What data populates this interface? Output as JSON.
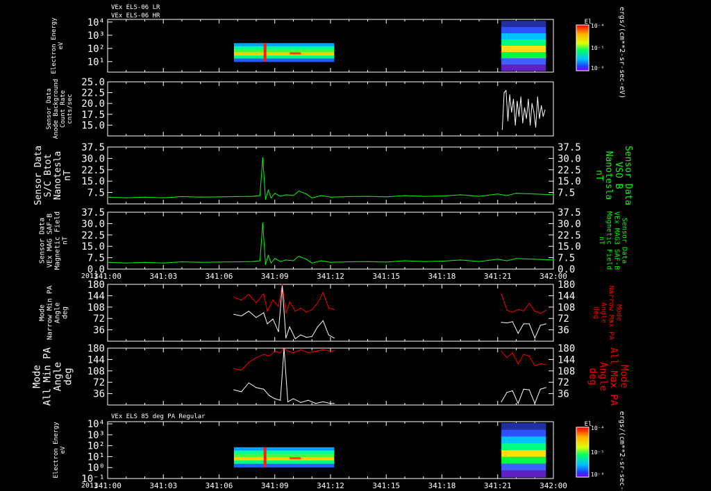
{
  "title_lines": [
    "VEx ELS-06 LR",
    "VEx ELS-06 HR"
  ],
  "bottom_panel_title": "VEx ELS 85 deg PA Regular",
  "colorbar_label": "ergs/(cm**2-sr-sec-eV)",
  "colorbar_title": "El",
  "colorbar_ticks": [
    "10⁻⁴",
    "10⁻⁵",
    "10⁻⁶"
  ],
  "time_axis": {
    "year": "2011",
    "ticks": [
      "341:00",
      "341:03",
      "341:06",
      "341:09",
      "341:12",
      "341:15",
      "341:18",
      "341:21",
      "342:00"
    ]
  },
  "colors": {
    "green": "#00ff00",
    "red": "#ff0000",
    "white": "#ffffff",
    "black": "#000000"
  },
  "chart_data": [
    {
      "type": "heatmap",
      "name": "energy-spectrogram-top",
      "ylabel": [
        "Electron Energy",
        "eV"
      ],
      "ytick_labels": [
        "10⁴",
        "10³",
        "10²",
        "10¹"
      ],
      "x_segments": [
        [
          6.8,
          12.2
        ],
        [
          21.2,
          23.6
        ]
      ]
    },
    {
      "type": "line",
      "name": "background-counts",
      "ylabel": [
        "Sensor Data",
        "Anode Background",
        "Count Rate",
        "cnts/sec"
      ],
      "ylim": [
        12.5,
        25.0
      ],
      "ytick_labels": [
        "25.0",
        "22.5",
        "20.0",
        "17.5",
        "15.0"
      ],
      "series": [
        {
          "color": "white",
          "x": [
            21.25,
            21.35,
            21.45,
            21.55,
            21.65,
            21.75,
            21.85,
            21.95,
            22.05,
            22.15,
            22.25,
            22.35,
            22.45,
            22.55,
            22.65,
            22.75,
            22.85,
            22.95,
            23.05,
            23.15,
            23.25,
            23.35,
            23.45,
            23.55
          ],
          "y": [
            14.0,
            22.5,
            23.0,
            16.0,
            22.0,
            18.0,
            21.0,
            15.0,
            20.5,
            17.0,
            21.5,
            15.5,
            19.0,
            16.5,
            21.0,
            15.0,
            20.0,
            18.0,
            14.5,
            21.5,
            16.5,
            19.5,
            17.0,
            18.5
          ]
        }
      ]
    },
    {
      "type": "line",
      "name": "mag-sc-btot",
      "ylabel": [
        "Sensor Data",
        "S/C Btot",
        "Nanotesla",
        "nT"
      ],
      "ylabel_right": [
        "Sensor Data",
        "VSO B",
        "Nanotesla",
        "nT"
      ],
      "ylim": [
        0,
        37.5
      ],
      "ytick_labels": [
        "37.5",
        "30.0",
        "22.5",
        "15.0",
        "7.5"
      ],
      "series": [
        {
          "color": "green",
          "x": [
            0,
            1,
            2,
            3,
            4,
            5,
            6,
            7,
            7.8,
            8.2,
            8.35,
            8.5,
            8.65,
            8.8,
            9.0,
            9.3,
            9.6,
            10.0,
            10.3,
            10.7,
            11.0,
            11.5,
            12.0,
            13.0,
            14.0,
            15.0,
            16.0,
            17.0,
            18.0,
            19.0,
            20.0,
            21.0,
            21.5,
            22.0,
            23.0,
            24.0
          ],
          "y": [
            4.5,
            4.0,
            4.5,
            4.0,
            4.8,
            4.5,
            4.6,
            4.8,
            5.0,
            5.5,
            30.5,
            3.0,
            9.0,
            4.0,
            7.0,
            5.0,
            6.0,
            5.5,
            8.5,
            6.5,
            4.0,
            5.5,
            4.5,
            4.8,
            5.0,
            4.6,
            5.5,
            5.0,
            5.2,
            6.0,
            5.0,
            6.5,
            5.5,
            7.0,
            6.5,
            6.0
          ]
        }
      ]
    },
    {
      "type": "line",
      "name": "mag-saf-b",
      "ylabel": [
        "Sensor Data",
        "VEx MAG SAF-B",
        "Magnetic Field",
        "nT"
      ],
      "ylabel_right": [
        "Sensor Data",
        "VEx MAG3 SAF-B",
        "Magnetic Field",
        "nT"
      ],
      "ylim": [
        0,
        37.5
      ],
      "ytick_labels": [
        "37.5",
        "30.0",
        "22.5",
        "15.0",
        "7.5",
        "0.0"
      ],
      "series": [
        {
          "color": "green",
          "x": [
            0,
            1,
            2,
            3,
            4,
            5,
            6,
            7,
            7.8,
            8.2,
            8.35,
            8.5,
            8.65,
            8.8,
            9.0,
            9.3,
            9.6,
            10.0,
            10.3,
            10.7,
            11.0,
            11.5,
            12.0,
            13.0,
            14.0,
            15.0,
            16.0,
            17.0,
            18.0,
            19.0,
            20.0,
            21.0,
            21.5,
            22.0,
            23.0,
            24.0
          ],
          "y": [
            4.5,
            4.0,
            4.5,
            4.0,
            4.8,
            4.5,
            4.6,
            4.8,
            5.0,
            5.5,
            30.5,
            3.0,
            9.0,
            4.0,
            7.0,
            5.0,
            6.0,
            5.5,
            8.5,
            6.5,
            4.0,
            5.5,
            4.5,
            4.8,
            5.0,
            4.6,
            5.5,
            5.0,
            5.2,
            6.0,
            5.0,
            6.5,
            5.5,
            7.0,
            6.5,
            6.0
          ]
        }
      ]
    },
    {
      "type": "line",
      "name": "narrow-pa",
      "ylabel": [
        "Mode",
        "Narrow Min PA",
        "Angle",
        "deg"
      ],
      "ylabel_right": [
        "Mode",
        "Narrow Max PA",
        "Angle",
        "deg"
      ],
      "ylim": [
        0,
        180
      ],
      "ytick_labels": [
        "180",
        "144",
        "108",
        "72",
        "36"
      ],
      "series": [
        {
          "color": "red",
          "x": [
            6.8,
            7.2,
            7.6,
            8.0,
            8.4,
            8.6,
            8.9,
            9.2,
            9.4,
            9.6,
            9.8,
            10.1,
            10.4,
            10.7,
            11.0,
            11.3,
            11.6,
            11.9,
            12.2
          ],
          "y": [
            140,
            130,
            148,
            122,
            150,
            95,
            130,
            110,
            180,
            88,
            125,
            95,
            105,
            92,
            100,
            120,
            155,
            105,
            100
          ]
        },
        {
          "color": "white",
          "x": [
            6.8,
            7.2,
            7.6,
            8.0,
            8.4,
            8.6,
            8.9,
            9.2,
            9.4,
            9.6,
            9.8,
            10.1,
            10.4,
            10.7,
            11.0,
            11.3,
            11.6,
            11.9,
            12.2
          ],
          "y": [
            85,
            80,
            95,
            75,
            90,
            55,
            70,
            30,
            175,
            10,
            45,
            8,
            20,
            12,
            15,
            45,
            65,
            20,
            10
          ]
        },
        {
          "color": "red",
          "x": [
            21.2,
            21.5,
            21.8,
            22.1,
            22.4,
            22.7,
            23.0,
            23.3,
            23.6
          ],
          "y": [
            150,
            98,
            92,
            100,
            96,
            120,
            95,
            88,
            98
          ]
        },
        {
          "color": "white",
          "x": [
            21.2,
            21.5,
            21.8,
            22.1,
            22.4,
            22.7,
            23.0,
            23.3,
            23.6
          ],
          "y": [
            60,
            58,
            62,
            25,
            55,
            55,
            10,
            50,
            55
          ]
        }
      ]
    },
    {
      "type": "line",
      "name": "all-pa",
      "ylabel": [
        "Mode",
        "All Min PA",
        "Angle",
        "deg"
      ],
      "ylabel_right": [
        "Mode",
        "All Max PA",
        "Angle",
        "deg"
      ],
      "ylim": [
        0,
        180
      ],
      "ytick_labels": [
        "180",
        "144",
        "108",
        "72",
        "36"
      ],
      "series": [
        {
          "color": "red",
          "x": [
            6.8,
            7.2,
            7.6,
            8.0,
            8.4,
            8.7,
            9.0,
            9.3,
            9.5,
            9.7,
            10.0,
            10.4,
            10.8,
            11.2,
            11.6,
            12.0,
            12.2
          ],
          "y": [
            115,
            110,
            135,
            150,
            160,
            155,
            170,
            165,
            180,
            170,
            165,
            175,
            165,
            170,
            175,
            170,
            172
          ]
        },
        {
          "color": "white",
          "x": [
            6.8,
            7.2,
            7.6,
            8.0,
            8.4,
            8.7,
            9.0,
            9.3,
            9.5,
            9.7,
            10.0,
            10.4,
            10.8,
            11.2,
            11.6,
            12.0,
            12.2
          ],
          "y": [
            48,
            42,
            70,
            55,
            50,
            30,
            20,
            15,
            180,
            10,
            20,
            8,
            15,
            5,
            10,
            5,
            5
          ]
        },
        {
          "color": "red",
          "x": [
            21.2,
            21.5,
            21.8,
            22.1,
            22.4,
            22.7,
            23.0,
            23.3,
            23.6
          ],
          "y": [
            170,
            150,
            165,
            130,
            160,
            155,
            125,
            130,
            128
          ]
        },
        {
          "color": "white",
          "x": [
            21.2,
            21.5,
            21.8,
            22.1,
            22.4,
            22.7,
            23.0,
            23.3,
            23.6
          ],
          "y": [
            10,
            40,
            45,
            5,
            50,
            48,
            5,
            50,
            55
          ]
        }
      ]
    },
    {
      "type": "heatmap",
      "name": "energy-spectrogram-85deg",
      "ylabel": [
        "Electron Energy",
        "eV"
      ],
      "ytick_labels": [
        "10⁴",
        "10³",
        "10²",
        "10¹",
        "10⁰",
        "10⁻¹"
      ],
      "x_segments": [
        [
          6.8,
          12.2
        ],
        [
          21.2,
          23.6
        ]
      ]
    }
  ]
}
